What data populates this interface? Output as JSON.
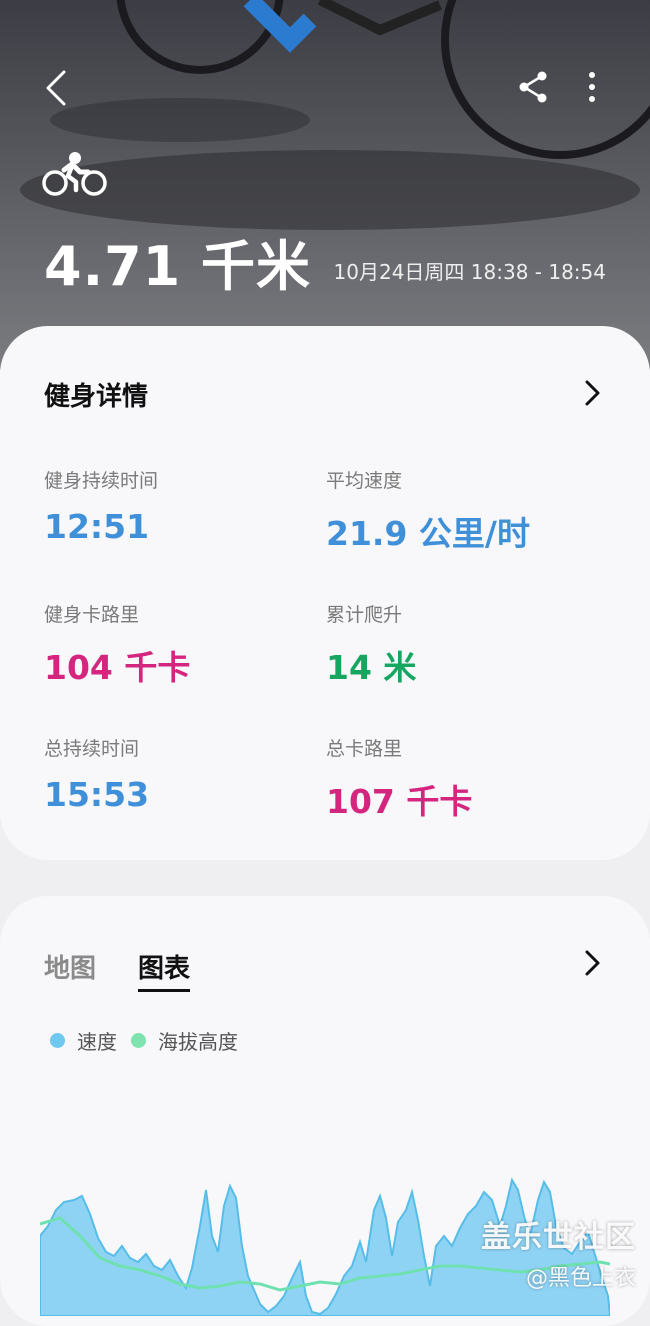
{
  "header": {
    "distance": "4.71 千米",
    "date_range": "10月24日周四 18:38 - 18:54"
  },
  "details": {
    "title": "健身详情",
    "stats": [
      {
        "label": "健身持续时间",
        "value": "12:51"
      },
      {
        "label": "平均速度",
        "value": "21.9 公里/时"
      },
      {
        "label": "健身卡路里",
        "value": "104 千卡"
      },
      {
        "label": "累计爬升",
        "value": "14 米"
      },
      {
        "label": "总持续时间",
        "value": "15:53"
      },
      {
        "label": "总卡路里",
        "value": "107 千卡"
      }
    ]
  },
  "charts": {
    "tabs": [
      {
        "label": "地图",
        "selected": false
      },
      {
        "label": "图表",
        "selected": true
      }
    ],
    "legend": [
      {
        "label": "速度",
        "color": "#6ec8f0"
      },
      {
        "label": "海拔高度",
        "color": "#7fe3b0"
      }
    ]
  },
  "watermark": {
    "title": "盖乐世社区",
    "handle": "@黑色上衣"
  },
  "colors": {
    "time": "#3f8fd9",
    "calories": "#d4257f",
    "elevation": "#16a660"
  },
  "icons": [
    "back-arrow-icon",
    "share-icon",
    "more-vertical-icon",
    "cycling-icon",
    "chevron-right-icon"
  ]
}
